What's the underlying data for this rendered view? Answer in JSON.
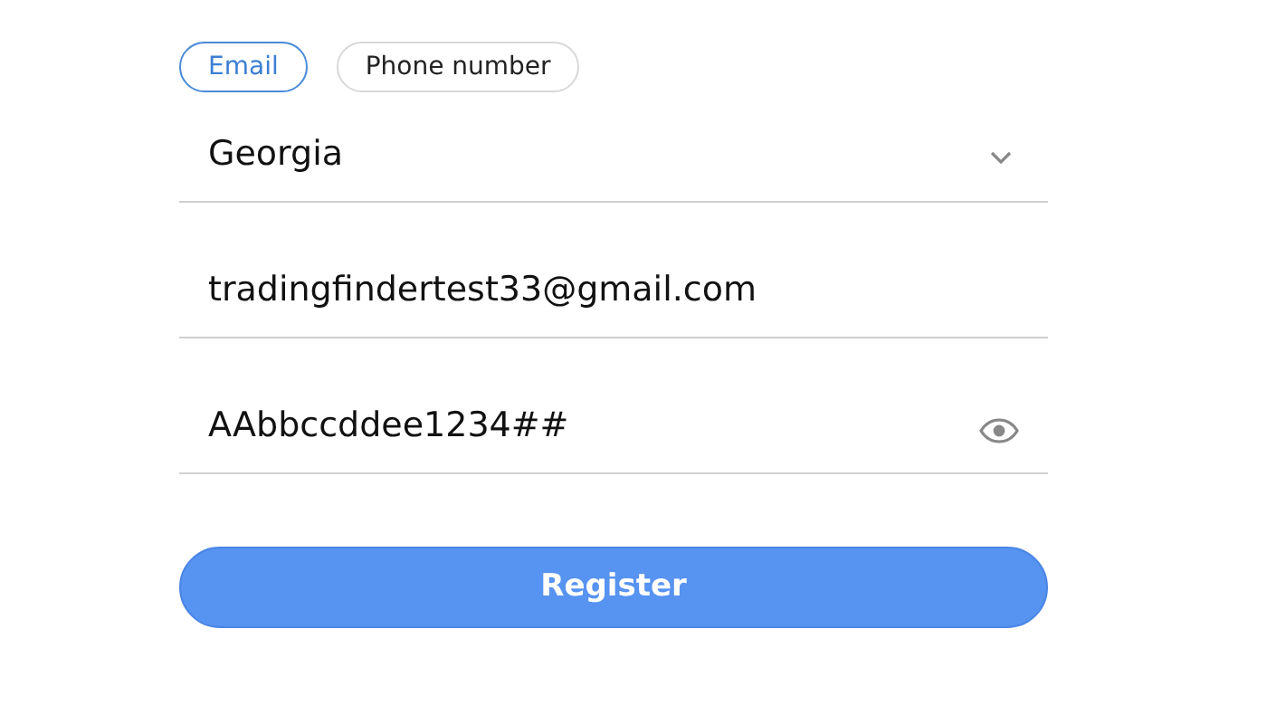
{
  "tabs": [
    {
      "label": "Email",
      "selected": true
    },
    {
      "label": "Phone number",
      "selected": false
    }
  ],
  "fields": [
    {
      "kind": "select",
      "value": "Georgia"
    },
    {
      "kind": "text",
      "value": "tradingfindertest33@gmail.com"
    },
    {
      "kind": "password",
      "value": "AAbbccddee1234##"
    }
  ],
  "submit": {
    "label": "Register"
  }
}
